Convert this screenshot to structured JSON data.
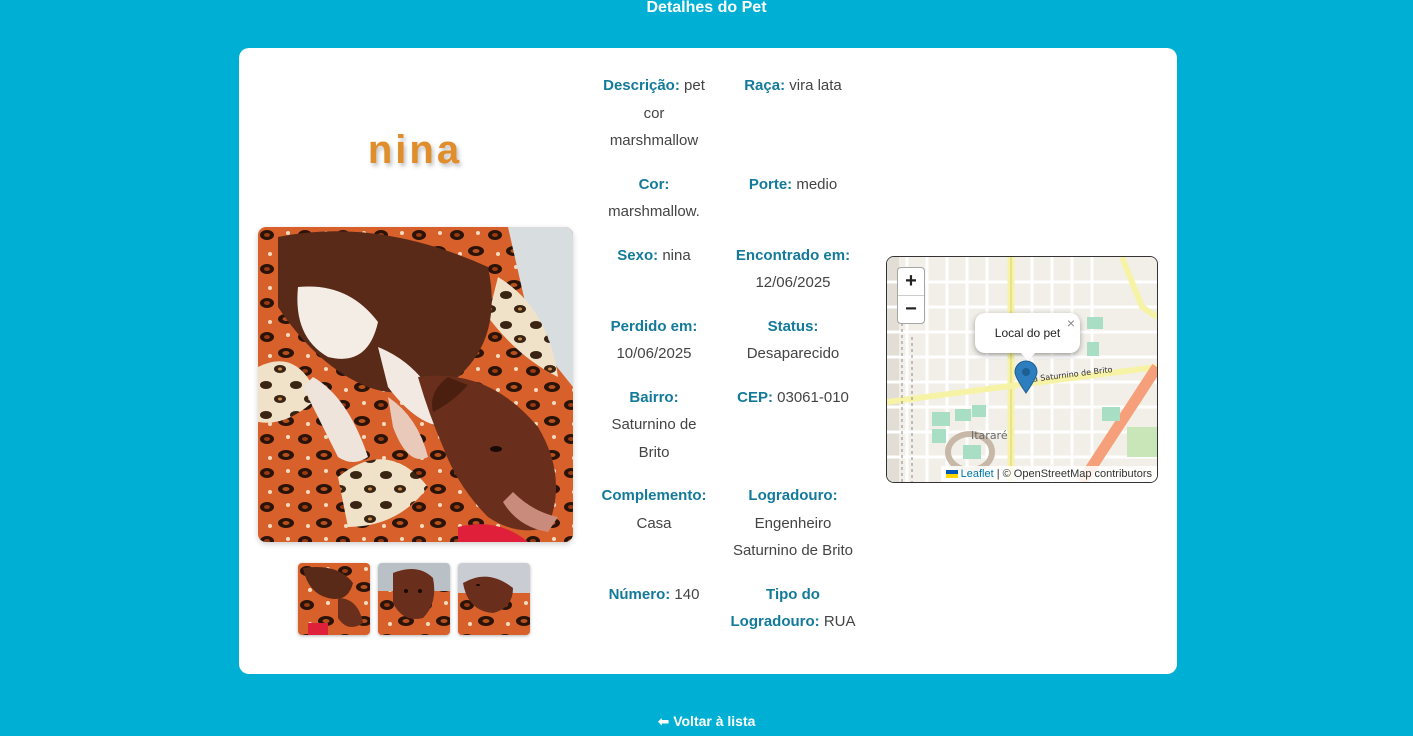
{
  "header": {
    "title": "Detalhes do Pet"
  },
  "pet": {
    "name": "nina",
    "fields": [
      {
        "label": "Descrição:",
        "value": "pet cor marshmallow"
      },
      {
        "label": "Raça:",
        "value": "vira lata"
      },
      {
        "label": "Cor:",
        "value": "marshmallow."
      },
      {
        "label": "Porte:",
        "value": "medio"
      },
      {
        "label": "Sexo:",
        "value": "nina"
      },
      {
        "label": "Encontrado em:",
        "value": "12/06/2025"
      },
      {
        "label": "Perdido em:",
        "value": "10/06/2025"
      },
      {
        "label": "Status:",
        "value": "Desaparecido"
      },
      {
        "label": "Bairro:",
        "value": "Saturnino de Brito"
      },
      {
        "label": "CEP:",
        "value": "03061-010"
      },
      {
        "label": "Complemento:",
        "value": "Casa"
      },
      {
        "label": "Logradouro:",
        "value": "Engenheiro Saturnino de Brito"
      },
      {
        "label": "Número:",
        "value": "140"
      },
      {
        "label": "Tipo do Logradouro:",
        "value": "RUA"
      }
    ]
  },
  "map": {
    "zoom_in": "+",
    "zoom_out": "−",
    "popup_text": "Local do pet",
    "popup_close": "×",
    "street_label": "Rua Saturnino de Brito",
    "district_label": "Itararé",
    "attribution_link": "Leaflet",
    "attribution_text": "| © OpenStreetMap contributors"
  },
  "footer": {
    "back_label": "⬅ Voltar à lista"
  }
}
